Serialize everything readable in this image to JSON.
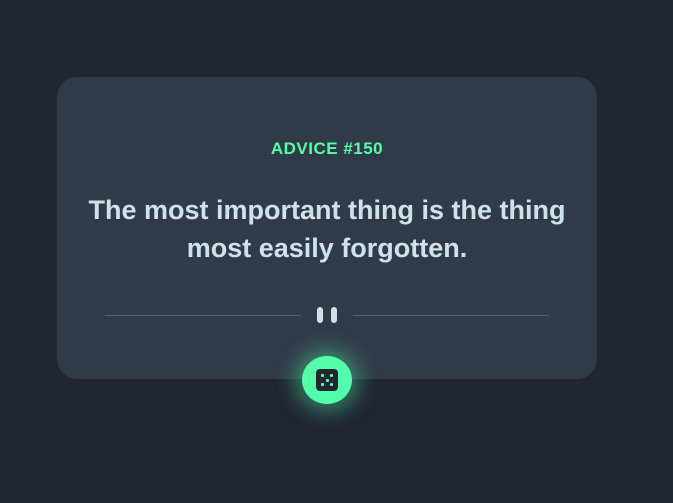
{
  "advice": {
    "id_label": "ADVICE #150",
    "quote": "The most important thing is the thing most easily forgotten."
  },
  "colors": {
    "background": "#202632",
    "card": "#313a48",
    "accent": "#53ffaa",
    "text": "#cee3e9",
    "divider": "#4f5d74"
  },
  "icons": {
    "divider_icon": "pause-icon",
    "button_icon": "dice-icon"
  }
}
